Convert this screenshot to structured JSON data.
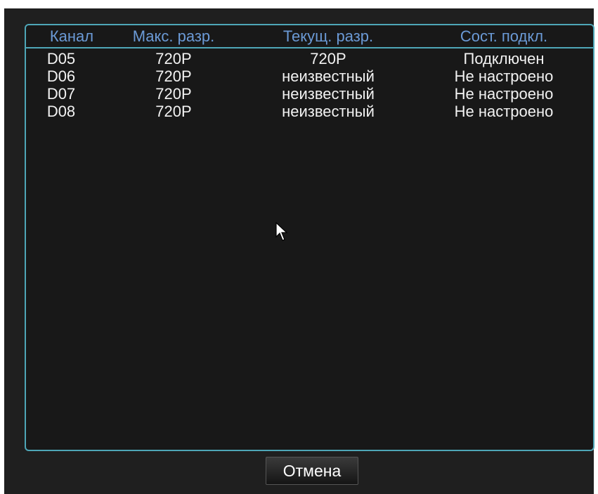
{
  "table": {
    "headers": [
      "Канал",
      "Макс. разр.",
      "Текущ. разр.",
      "Сост. подкл."
    ],
    "rows": [
      [
        "D05",
        "720P",
        "720P",
        "Подключен"
      ],
      [
        "D06",
        "720P",
        "неизвестный",
        "Не настроено"
      ],
      [
        "D07",
        "720P",
        "неизвестный",
        "Не настроено"
      ],
      [
        "D08",
        "720P",
        "неизвестный",
        "Не настроено"
      ]
    ]
  },
  "buttons": {
    "cancel_label": "Отмена"
  },
  "colors": {
    "background": "#1f1f1f",
    "border": "#4ea6b7",
    "header_text": "#6b9ad6",
    "row_text": "#f2f2f2"
  },
  "icons": {
    "cursor": "mouse-pointer-icon"
  }
}
